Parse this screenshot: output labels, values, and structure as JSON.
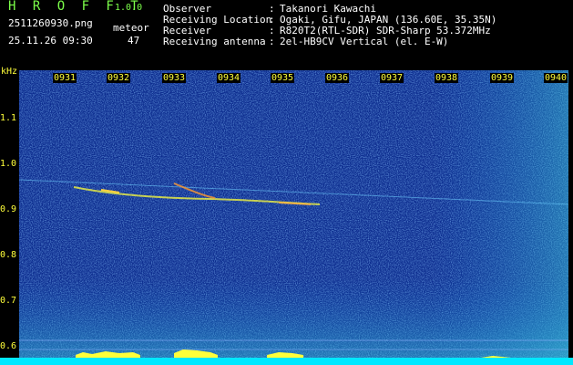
{
  "header": {
    "logo": "H R O F F T",
    "version": "1.0.0",
    "filename": "2511260930.png",
    "meteor_label": "meteor",
    "timestamp": "25.11.26 09:30",
    "meteor_count": "47"
  },
  "info": {
    "observer_label": "Observer",
    "observer_value": "Takanori Kawachi",
    "location_label": "Receiving Location",
    "location_value": "Ogaki, Gifu, JAPAN (136.60E, 35.35N)",
    "receiver_label": "Receiver",
    "receiver_value": "R820T2(RTL-SDR) SDR-Sharp 53.372MHz",
    "antenna_label": "Receiving antenna",
    "antenna_value": "2el-HB9CV Vertical (el. E-W)",
    "separator": ":"
  },
  "axis": {
    "y_unit": "kHz",
    "y_ticks": [
      "1.1",
      "1.0",
      "0.9",
      "0.8",
      "0.7",
      "0.6"
    ],
    "x_ticks": [
      "0931",
      "0932",
      "0933",
      "0934",
      "0935",
      "0936",
      "0937",
      "0938",
      "0939",
      "0940"
    ]
  },
  "colors": {
    "background": "#0d2d8f",
    "trace": "#ffff3a",
    "bottom_band": "#00e8ff",
    "header_green": "#7cff4a"
  }
}
